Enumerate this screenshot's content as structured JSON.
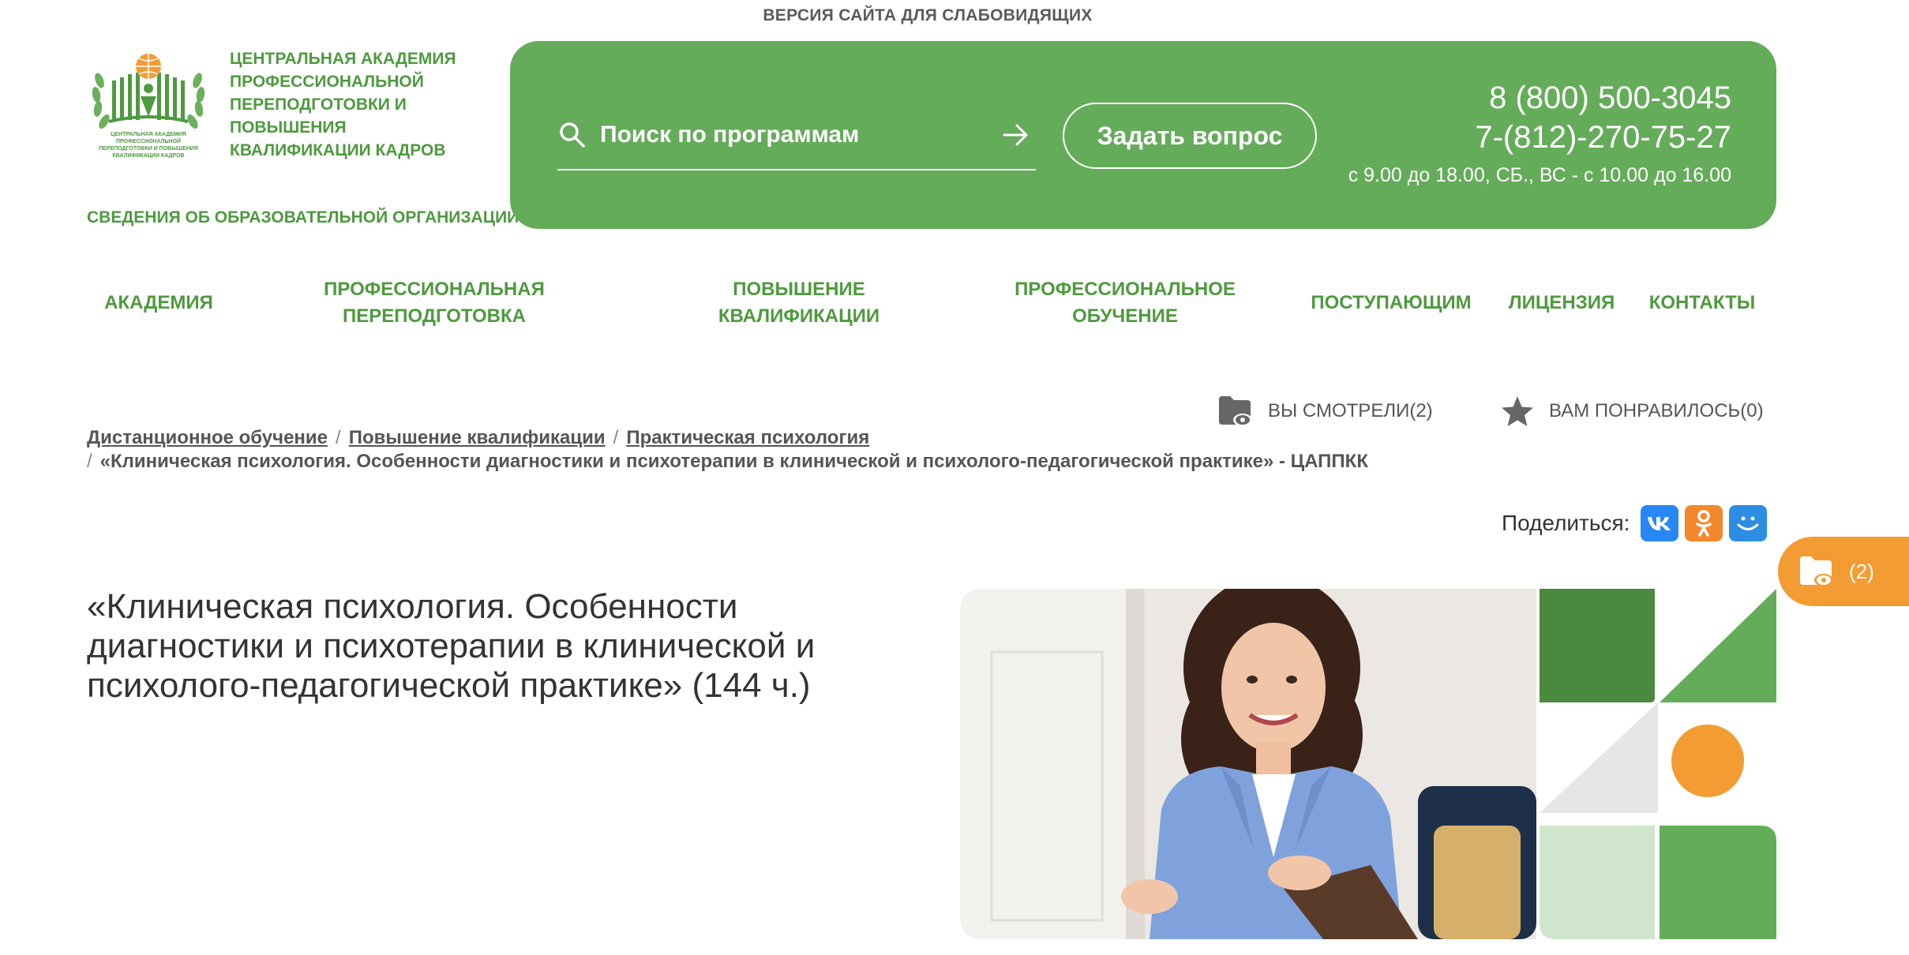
{
  "top": {
    "low_vision_link": "ВЕРСИЯ САЙТА ДЛЯ СЛАБОВИДЯЩИХ"
  },
  "logo": {
    "title": "ЦЕНТРАЛЬНАЯ АКАДЕМИЯ ПРОФЕССИОНАЛЬНОЙ ПЕРЕПОДГОТОВКИ И ПОВЫШЕНИЯ КВАЛИФИКАЦИИ КАДРОВ",
    "emblem_text": "ЦЕНТРАЛЬНАЯ АКАДЕМИЯ ПРОФЕССИОНАЛЬНОЙ ПЕРЕПОДГОТОВКИ И ПОВЫШЕНИЯ КВАЛИФИКАЦИИ КАДРОВ"
  },
  "edu_org_link": "СВЕДЕНИЯ ОБ ОБРАЗОВАТЕЛЬНОЙ ОРГАНИЗАЦИИ",
  "header": {
    "search_placeholder": "Поиск по программам",
    "ask_button": "Задать вопрос",
    "phone1": "8 (800) 500-3045",
    "phone2": "7-(812)-270-75-27",
    "hours": "с 9.00 до 18.00, СБ., ВС - с 10.00 до 16.00"
  },
  "nav": [
    {
      "label": "АКАДЕМИЯ"
    },
    {
      "label": "ПРОФЕССИОНАЛЬНАЯ\nПЕРЕПОДГОТОВКА"
    },
    {
      "label": "ПОВЫШЕНИЕ\nКВАЛИФИКАЦИИ"
    },
    {
      "label": "ПРОФЕССИОНАЛЬНОЕ\nОБУЧЕНИЕ"
    },
    {
      "label": "ПОСТУПАЮЩИМ"
    },
    {
      "label": "ЛИЦЕНЗИЯ"
    },
    {
      "label": "КОНТАКТЫ"
    }
  ],
  "user_lists": {
    "viewed": "ВЫ СМОТРЕЛИ(2)",
    "liked": "ВАМ ПОНРАВИЛОСЬ(0)"
  },
  "breadcrumbs": {
    "items": [
      "Дистанционное обучение",
      "Повышение квалификации",
      "Практическая психология"
    ],
    "current": "«Клиническая психология. Особенности диагностики и психотерапии в клинической и психолого-педагогической практике» - ЦАППКК",
    "separator": "/"
  },
  "share": {
    "label": "Поделиться:",
    "buttons": [
      {
        "name": "vk",
        "text": "VK",
        "color": "#2787f5"
      },
      {
        "name": "ok",
        "text": "ок",
        "color": "#f2882b"
      },
      {
        "name": "mail",
        "text": "◡",
        "color": "#2d8de3"
      }
    ]
  },
  "side_viewed": {
    "count": "(2)"
  },
  "course": {
    "title": "«Клиническая психология. Особенности диагностики и психотерапии в клинической и психолого-педагогической практике» (144 ч.)"
  },
  "colors": {
    "brand_green": "#65ac5a",
    "text_green": "#4e9a3e",
    "accent_orange": "#f39c33",
    "dark_green": "#4a8a3e",
    "light_green": "#cfe6cc"
  }
}
